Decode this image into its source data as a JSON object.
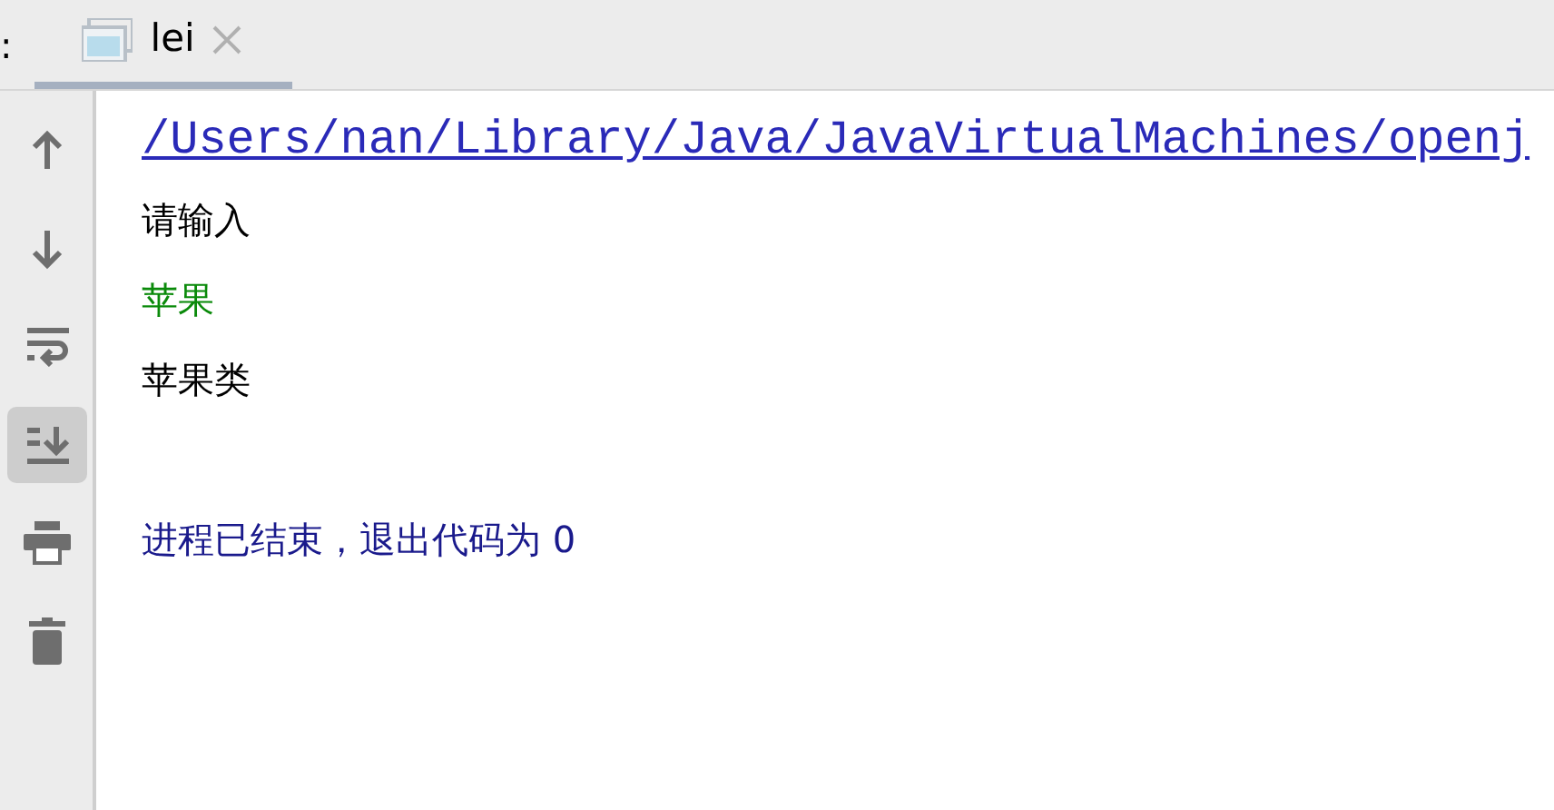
{
  "tab_bar": {
    "cut_label": ":",
    "tabs": [
      {
        "label": "lei",
        "selected": true
      }
    ]
  },
  "toolbar": [
    {
      "kind": "up",
      "selected": false
    },
    {
      "kind": "down",
      "selected": false
    },
    {
      "kind": "wrap",
      "selected": false
    },
    {
      "kind": "scroll",
      "selected": true
    },
    {
      "kind": "print",
      "selected": false
    },
    {
      "kind": "trash",
      "selected": false
    }
  ],
  "console": [
    {
      "kind": "link",
      "text": "/Users/nan/Library/Java/JavaVirtualMachines/openj"
    },
    {
      "kind": "output",
      "text": "请输入"
    },
    {
      "kind": "input",
      "text": "苹果"
    },
    {
      "kind": "output",
      "text": "苹果类"
    },
    {
      "kind": "blank"
    },
    {
      "kind": "system",
      "text": "进程已结束，退出代码为 0"
    }
  ]
}
